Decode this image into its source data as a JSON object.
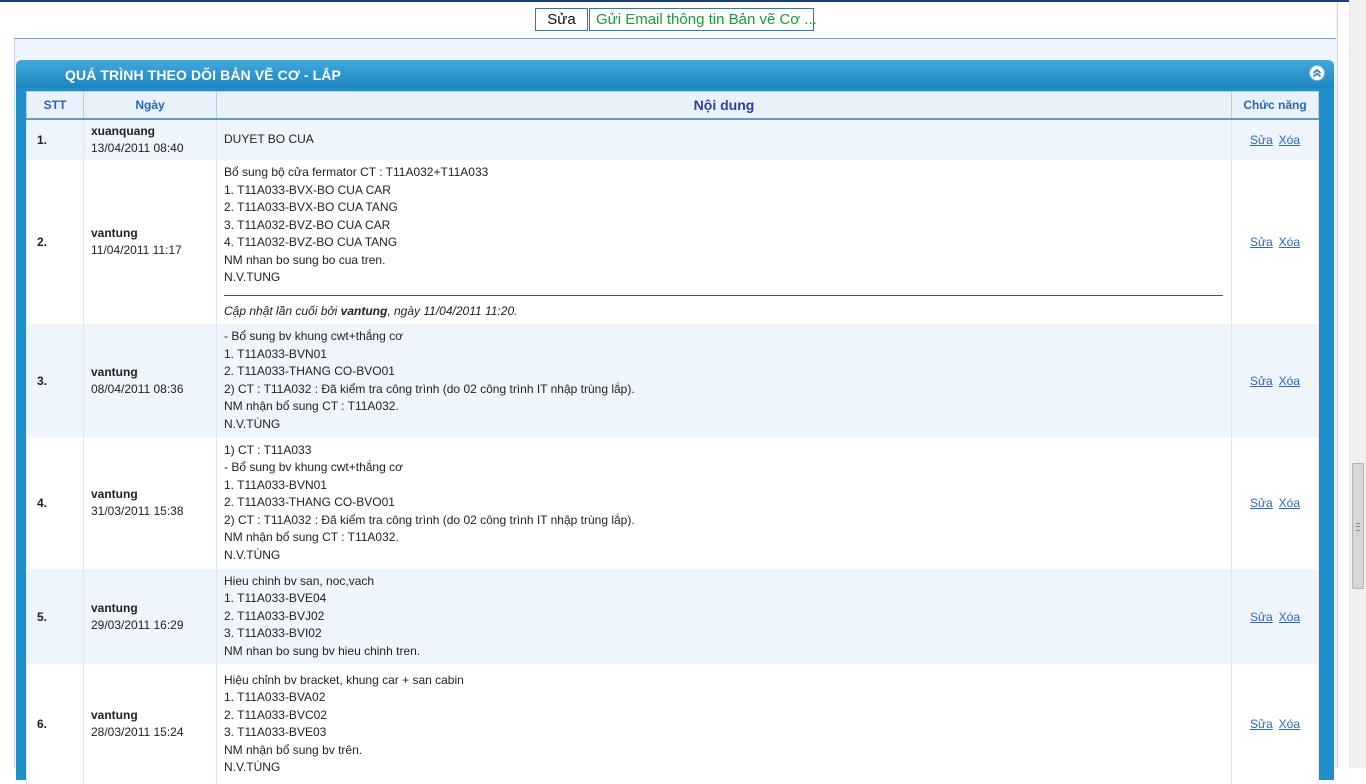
{
  "toolbar": {
    "edit_label": "Sửa",
    "email_label": "Gửi Email thông tin Bản vẽ Cơ ..."
  },
  "panel": {
    "title": "QUÁ TRÌNH THEO DÕI BẢN VẼ CƠ - LẮP",
    "collapse_icon": "double-chevron-up-icon"
  },
  "table": {
    "headers": {
      "stt": "STT",
      "date": "Ngày",
      "content": "Nội dung",
      "func": "Chức năng"
    },
    "edit_link": "Sửa",
    "delete_link": "Xóa",
    "rows": [
      {
        "stt": "1.",
        "user": "xuanquang",
        "time": "13/04/2011 08:40",
        "lines": [
          "DUYET BO CUA"
        ]
      },
      {
        "stt": "2.",
        "user": "vantung",
        "time": "11/04/2011 11:17",
        "lines": [
          "Bổ sung bộ cửa fermator CT : T11A032+T11A033",
          "1. T11A033-BVX-BO CUA CAR",
          "2. T11A033-BVX-BO CUA TANG",
          "3. T11A032-BVZ-BO CUA CAR",
          "4. T11A032-BVZ-BO CUA TANG",
          "NM nhan bo sung bo cua tren.",
          "N.V.TUNG"
        ],
        "update_prefix": "Cập nhật lần cuối bởi ",
        "update_user": "vantung",
        "update_suffix": ", ngày 11/04/2011 11:20."
      },
      {
        "stt": "3.",
        "user": "vantung",
        "time": "08/04/2011 08:36",
        "lines": [
          "- Bổ sung bv khung cwt+thắng cơ",
          "1. T11A033-BVN01",
          "2. T11A033-THANG CO-BVO01",
          "2) CT : T11A032 : Đã kiểm tra công trình (do 02 công trình IT nhập trùng lắp).",
          "NM nhận bổ sung CT : T11A032.",
          "N.V.TÙNG"
        ]
      },
      {
        "stt": "4.",
        "user": "vantung",
        "time": "31/03/2011 15:38",
        "lines": [
          "1) CT : T11A033",
          "- Bổ sung bv khung cwt+thắng cơ",
          "1. T11A033-BVN01",
          "2. T11A033-THANG CO-BVO01",
          "2) CT : T11A032 : Đã kiểm tra công trình (do 02 công trình IT nhập trùng lắp).",
          "NM nhận bổ sung CT : T11A032.",
          "N.V.TÙNG"
        ]
      },
      {
        "stt": "5.",
        "user": "vantung",
        "time": "29/03/2011 16:29",
        "lines": [
          "Hieu chinh bv san, noc,vach",
          "1. T11A033-BVE04",
          "2. T11A033-BVJ02",
          "3. T11A033-BVI02",
          "NM nhan bo sung bv hieu chinh tren."
        ]
      },
      {
        "stt": "6.",
        "user": "vantung",
        "time": "28/03/2011 15:24",
        "lines": [
          "Hiệu chỉnh bv bracket, khung car + san cabin",
          "1. T11A033-BVA02",
          "2. T11A033-BVC02",
          "3. T11A033-BVE03",
          "NM nhận bổ sung bv trên.",
          "N.V.TÙNG"
        ]
      }
    ]
  }
}
